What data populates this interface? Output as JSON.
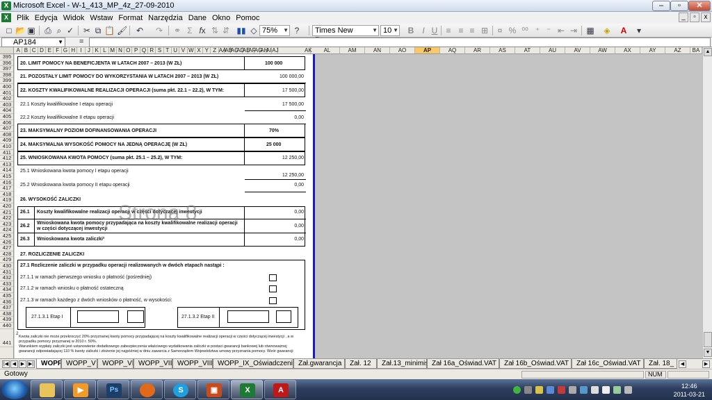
{
  "window": {
    "title": "Microsoft Excel - W-1_413_MP_4z_27-09-2010",
    "app_icon": "X"
  },
  "menu": [
    "Plik",
    "Edycja",
    "Widok",
    "Wstaw",
    "Format",
    "Narzędzia",
    "Dane",
    "Okno",
    "Pomoc"
  ],
  "toolbar": {
    "zoom": "75%",
    "font": "Times New Roman",
    "font_size": "10",
    "bold": "B",
    "italic": "I",
    "underline": "U",
    "percent": "%"
  },
  "formula_bar": {
    "name_box": "AP184",
    "eq": "=",
    "value": ""
  },
  "columns": [
    "A",
    "B",
    "C",
    "D",
    "E",
    "F",
    "G",
    "H",
    "I",
    "J",
    "K",
    "L",
    "M",
    "N",
    "O",
    "P",
    "Q",
    "R",
    "S",
    "T",
    "U",
    "V",
    "W",
    "X",
    "Y",
    "Z",
    "AA",
    "AB",
    "AC",
    "AD",
    "AE",
    "AF",
    "AG",
    "AH",
    "AI",
    "AJ",
    "AK",
    "AL",
    "AM",
    "AN",
    "AO",
    "AP",
    "AQ",
    "AR",
    "AS",
    "AT",
    "AU",
    "AV",
    "AW",
    "AX",
    "AY",
    "AZ",
    "BA"
  ],
  "selected_column": "AP",
  "rows": [
    "395",
    "396",
    "397",
    "398",
    "399",
    "400",
    "401",
    "402",
    "403",
    "404",
    "405",
    "406",
    "407",
    "408",
    "409",
    "410",
    "411",
    "412",
    "413",
    "414",
    "415",
    "416",
    "417",
    "418",
    "419",
    "420",
    "421",
    "422",
    "423",
    "424",
    "425",
    "426",
    "427",
    "428",
    "429",
    "430",
    "431",
    "432",
    "433",
    "434",
    "435",
    "436",
    "437",
    "438",
    "439",
    "440",
    "441"
  ],
  "form": {
    "r20": {
      "label": "20. LIMIT POMOCY NA BENEFICJENTA W LATACH 2007 – 2013 (W ZŁ)",
      "value": "100 000"
    },
    "r21": {
      "label": "21. POZOSTAŁY LIMIT POMOCY DO WYKORZYSTANIA W LATACH 2007 – 2013 (W ZŁ)",
      "value": "100 000,00"
    },
    "r22": {
      "label": "22. KOSZTY KWALIFIKOWALNE REALIZACJI OPERACJI (suma pkt. 22.1 – 22.2), W TYM:",
      "value": "17 500,00"
    },
    "r22_1": {
      "label": "22.1 Koszty kwalifikowalne I etapu operacji",
      "value": "17 500,00"
    },
    "r22_2": {
      "label": "22.2 Koszty kwalifikowalne II etapu operacji",
      "value": "0,00"
    },
    "r23": {
      "label": "23. MAKSYMALNY POZIOM DOFINANSOWANIA OPERACJI",
      "value": "70%"
    },
    "r24": {
      "label": "24. MAKSYMALNA WYSOKOŚĆ POMOCY NA JEDNĄ OPERACJĘ  (W ZŁ)",
      "value": "25 000"
    },
    "r25": {
      "label": "25. WNIOSKOWANA KWOTA POMOCY (suma pkt. 25.1 – 25.2), W TYM:",
      "value": "12 250,00"
    },
    "r25_1": {
      "label": "25.1 Wnioskowana kwota pomocy I etapu operacji",
      "value": "12 250,00"
    },
    "r25_2": {
      "label": "25.2 Wnioskowana kwota pomocy II etapu operacji",
      "value": "0,00"
    },
    "r26": {
      "label": "26. WYSOKOŚĆ ZALICZKI"
    },
    "r26_1": {
      "num": "26.1",
      "label": "Koszty kwalifikowalne realizacji operacji w części dotyczącej inwestycji",
      "value": "0,00"
    },
    "r26_2": {
      "num": "26.2",
      "label": "Wnioskowana kwota pomocy przypadająca na koszty kwalifikowalne realizacji operacji",
      "label2": "w części dotyczącej inwestycji",
      "value": "0,00"
    },
    "r26_3": {
      "num": "26.3",
      "label": "Wnioskowana kwota zaliczki²",
      "value": "0,00"
    },
    "r27": {
      "label": "27. ROZLICZENIE ZALICZKI"
    },
    "r27_1": {
      "label": "27.1 Rozliczenie zaliczki w przypadku operacji realizowanych w dwóch etapach nastąpi :"
    },
    "r27_1_1": {
      "label": "27.1.1 w ramach pierwszego wniosku o płatność (pośredniej)"
    },
    "r27_1_2": {
      "label": "27.1.2 w ramach wniosku o płatność ostateczną"
    },
    "r27_1_3": {
      "label": "27.1.3 w ramach każdego z dwóch wniosków o płatność, w wysokości:"
    },
    "etap1": "27.1.3.1 Etap I",
    "etap2": "27.1.3.2 Etap II",
    "fn_mark": "2",
    "footnote_line1": "Kwota zaliczki nie może przekroczyć 20% przyznanej kwoty pomocy przypadającej na koszty kwalifikowalne realizacji operacji w części dotyczącej inwestycji , a w",
    "footnote_line2": "przypadku pomocy przyznanej w 2010 r. 50%.",
    "footnote_line3": "Warunkiem wypłaty zaliczki jest ustanowienie dodatkowego zabezpieczenia właściwego wydatkowania zaliczki w postaci gwarancji bankowej lub równoważnej",
    "footnote_line4": "gwarancji odpowiadającej 110 % kwoty zaliczki i złożenie jej najpóźniej w dniu zawarcia z Samorządem Województwa umowy przyznania pomocy. Wzór gwarancji"
  },
  "watermark": "Strona 8",
  "sheet_tabs": [
    "WOPP",
    "WOPP_V",
    "WOPP_VI",
    "WOPP_VII",
    "WOPP_VIII",
    "WOPP_IX_Oświadczenie",
    "Zał.gwarancja",
    "Zał. 12",
    "Zał.13_minimis",
    "Zał 16a_Oświad.VAT",
    "Zał 16b_Oświad.VAT",
    "Zał 16c_Oświad.VAT",
    "Zał. 18_"
  ],
  "active_tab": "WOPP",
  "status": {
    "text": "Gotowy",
    "num": "NUM"
  },
  "clock": {
    "time": "12:46",
    "date": "2011-03-21"
  },
  "taskbar_apps": [
    "folder-icon",
    "media-player-icon",
    "photoshop-icon",
    "firefox-icon",
    "skype-icon",
    "powerpoint-icon",
    "excel-icon",
    "acrobat-icon"
  ]
}
